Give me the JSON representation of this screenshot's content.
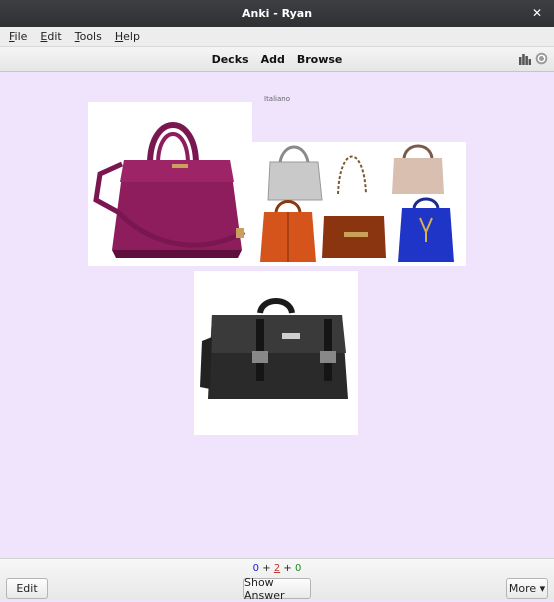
{
  "window": {
    "title": "Anki - Ryan",
    "close_glyph": "✕"
  },
  "menu": [
    {
      "first": "F",
      "rest": "ile"
    },
    {
      "first": "E",
      "rest": "dit"
    },
    {
      "first": "T",
      "rest": "ools"
    },
    {
      "first": "H",
      "rest": "elp"
    }
  ],
  "toolbar": {
    "decks": "Decks",
    "add": "Add",
    "browse": "Browse",
    "icons": [
      "stats-icon",
      "sync-icon"
    ]
  },
  "card": {
    "deck_name": "Italiano"
  },
  "counts": {
    "new": "0",
    "plus1": "+",
    "learn": "2",
    "plus2": "+",
    "review": "0"
  },
  "buttons": {
    "edit": "Edit",
    "show_answer": "Show Answer",
    "more": "More ▾"
  },
  "colors": {
    "new": "#1a1ad8",
    "learn": "#c0392b",
    "review": "#1a8a1a",
    "background": "#efe4fb"
  }
}
